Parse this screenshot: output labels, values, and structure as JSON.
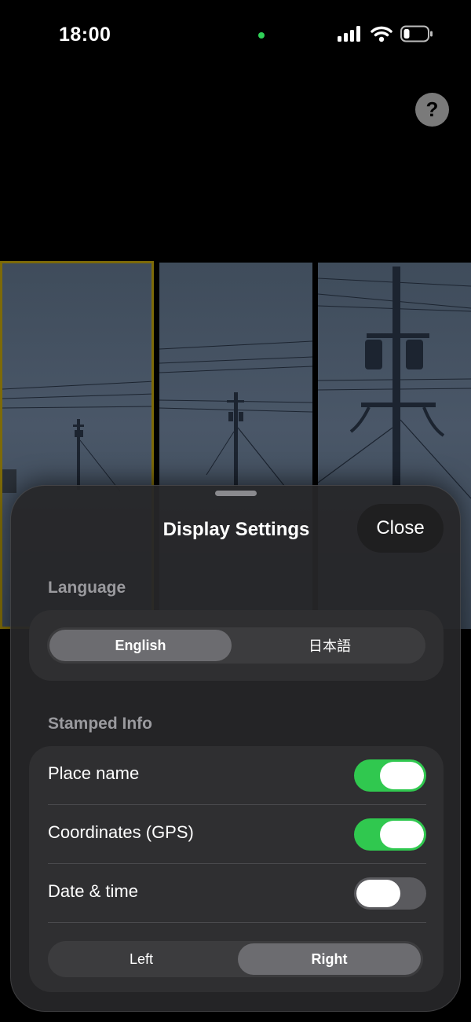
{
  "status_bar": {
    "time": "18:00"
  },
  "help": {
    "label": "?"
  },
  "sheet": {
    "title": "Display Settings",
    "close_label": "Close",
    "language": {
      "section_label": "Language",
      "options": [
        "English",
        "日本語"
      ],
      "selected": "English"
    },
    "stamped_info": {
      "section_label": "Stamped Info",
      "rows": [
        {
          "label": "Place name",
          "enabled": true
        },
        {
          "label": "Coordinates (GPS)",
          "enabled": true
        },
        {
          "label": "Date & time",
          "enabled": false
        }
      ],
      "position_options": [
        "Left",
        "Right"
      ],
      "position_selected": "Right"
    }
  },
  "colors": {
    "toggle_on": "#30c84f",
    "selection_border": "#7d6a08",
    "recording_dot": "#30d158"
  },
  "icons": [
    "signal-icon",
    "wifi-icon",
    "battery-icon",
    "help-icon"
  ]
}
